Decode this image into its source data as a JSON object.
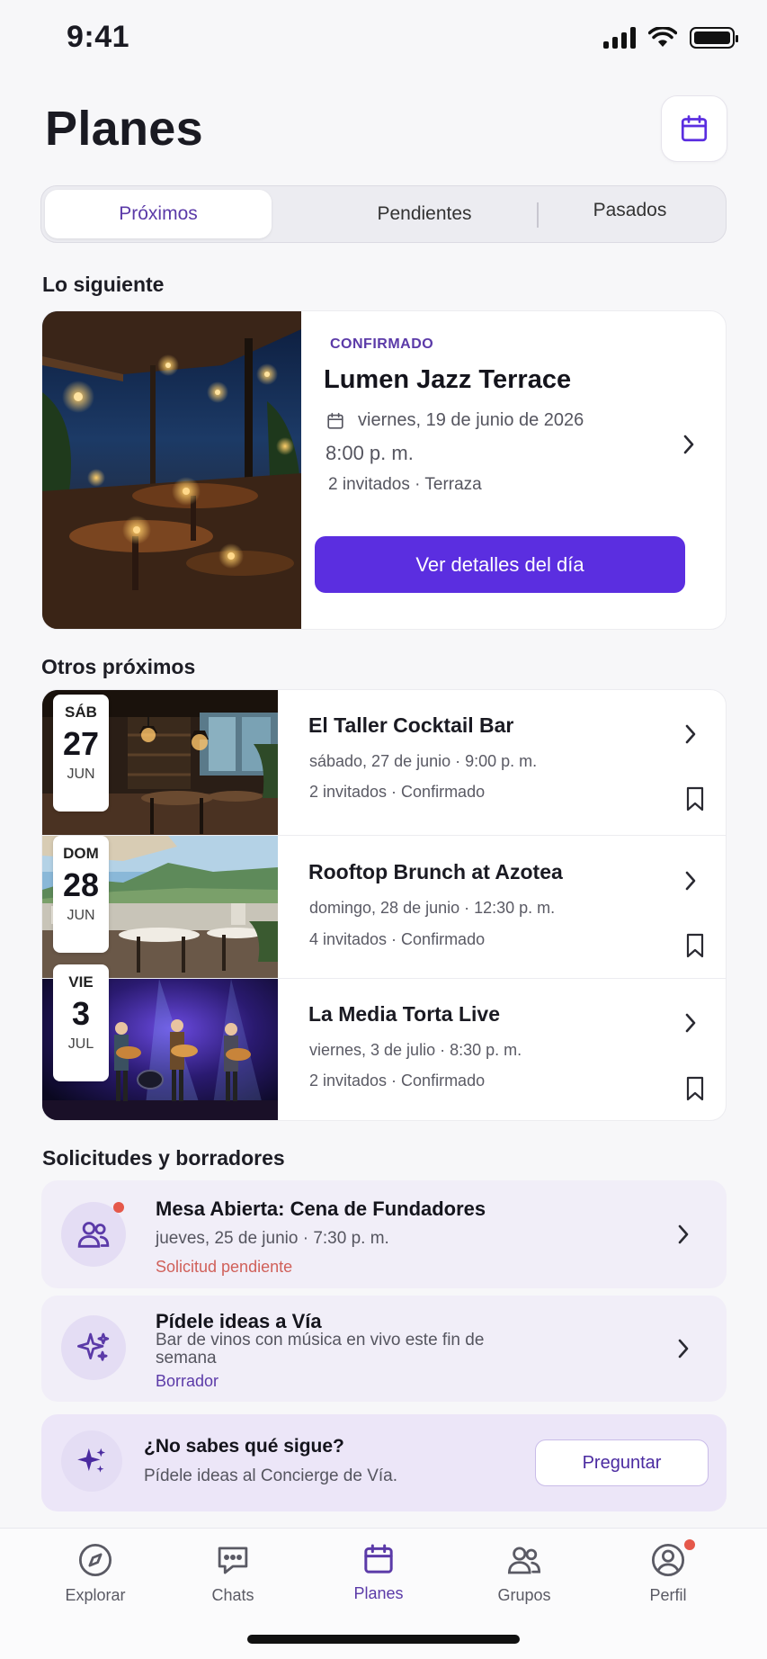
{
  "status_bar": {
    "time": "9:41"
  },
  "header": {
    "title": "Planes"
  },
  "tabs": [
    {
      "label": "Próximos",
      "active": true
    },
    {
      "label": "Pendientes",
      "active": false
    },
    {
      "label": "Pasados",
      "active": false
    }
  ],
  "featured": {
    "section_title": "Lo siguiente",
    "status": "CONFIRMADO",
    "name": "Lumen Jazz Terrace",
    "date": "viernes, 19 de junio de 2026",
    "time": "8:00 p. m.",
    "guests": "2 invitados · Terraza",
    "cta": "Ver detalles del día"
  },
  "upcoming": {
    "section_title": "Otros próximos",
    "items": [
      {
        "dow": "SÁB",
        "day": "27",
        "month": "JUN",
        "name": "El Taller Cocktail Bar",
        "date": "sábado, 27 de junio · 9:00 p. m.",
        "guests": "2 invitados · Confirmado"
      },
      {
        "dow": "DOM",
        "day": "28",
        "month": "JUN",
        "name": "Rooftop Brunch at Azotea",
        "date": "domingo, 28 de junio · 12:30 p. m.",
        "guests": "4 invitados · Confirmado"
      },
      {
        "dow": "VIE",
        "day": "3",
        "month": "JUL",
        "name": "La Media Torta Live",
        "date": "viernes, 3 de julio · 8:30 p. m.",
        "guests": "2 invitados · Confirmado"
      }
    ]
  },
  "requests": {
    "section_title": "Solicitudes y borradores",
    "items": [
      {
        "title": "Mesa Abierta: Cena de Fundadores",
        "subtitle": "jueves, 25 de junio · 7:30 p. m.",
        "status": "Solicitud pendiente",
        "status_color": "#d0605a",
        "icon": "users-icon"
      },
      {
        "title": "Pídele ideas a Vía",
        "subtitle": "Bar de vinos con música en vivo este fin de semana",
        "status": "Borrador",
        "status_color": "#5b3aa8",
        "icon": "sparkles-icon"
      }
    ]
  },
  "ask": {
    "title": "¿No sabes qué sigue?",
    "subtitle": "Pídele ideas al Concierge de Vía.",
    "button": "Preguntar"
  },
  "tab_bar": [
    {
      "label": "Explorar",
      "icon": "compass-icon",
      "active": false
    },
    {
      "label": "Chats",
      "icon": "chat-icon",
      "active": false
    },
    {
      "label": "Planes",
      "icon": "calendar-icon",
      "active": true
    },
    {
      "label": "Grupos",
      "icon": "users-icon",
      "active": false
    },
    {
      "label": "Perfil",
      "icon": "profile-icon",
      "active": false
    }
  ],
  "colors": {
    "accent": "#5b2ee0",
    "accent_text": "#5b3aa8",
    "notification": "#e5584a"
  }
}
